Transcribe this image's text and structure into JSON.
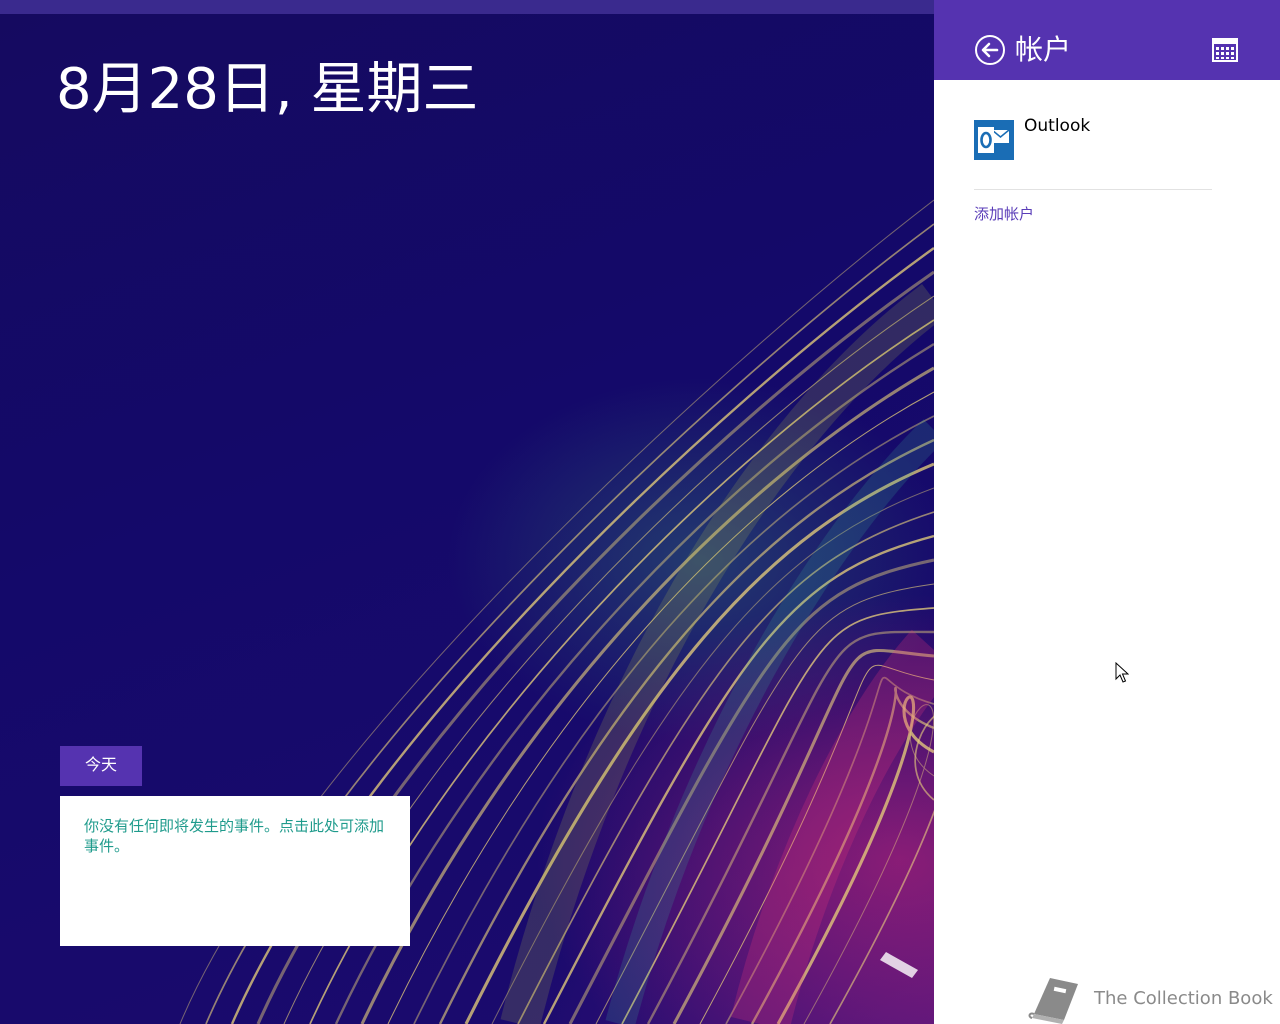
{
  "calendar": {
    "date_heading": "8月28日, 星期三",
    "today_button": "今天",
    "empty_message": "你没有任何即将发生的事件。点击此处可添加事件。"
  },
  "accounts_panel": {
    "title": "帐户",
    "back_icon": "back-arrow-circle-icon",
    "calendar_icon": "calendar-grid-icon",
    "accounts": [
      {
        "name": "Outlook",
        "icon": "outlook-icon"
      }
    ],
    "add_account": "添加帐户"
  },
  "watermark": {
    "text": "The Collection Book",
    "icon": "book-icon"
  },
  "colors": {
    "accent": "#5533b0",
    "background": "#150a60",
    "event_text": "#1f9b8c",
    "link": "#5a3db8",
    "outlook_blue": "#1a6db5"
  }
}
